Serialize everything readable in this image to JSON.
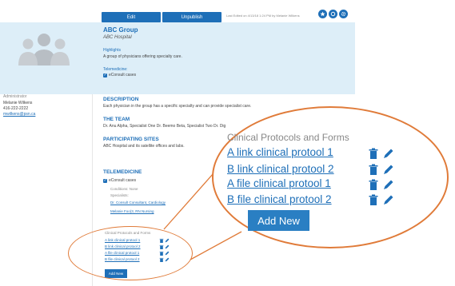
{
  "toolbar": {
    "edit_label": "Edit",
    "unpublish_label": "Unpublish",
    "last_edited": "Last Edited on 4/13/18 1:24 PM by Melanie Wilkens"
  },
  "header": {
    "title": "ABC Group",
    "subtitle": "ABC Hospital",
    "highlights_label": "Highlights",
    "highlights_text": "A group of physicians offering specialty care.",
    "telemedicine_label": "Telemedicine:",
    "telemedicine_item": "eConsult cases"
  },
  "sidebar": {
    "role": "Administrator",
    "name": "Melanie Wilkens",
    "phone": "416-222-2222",
    "email": "mwilkens@psn.ca"
  },
  "main": {
    "description_head": "DESCRIPTION",
    "description_text": "Each physician in the group has a specific specialty and can provide specialist care.",
    "team_head": "THE TEAM",
    "team_text": "Dr. Anu Alpha, Specialist One Dr. Beemo Beta, Specialist Two Dr. Dig",
    "sites_head": "PARTICIPATING SITES",
    "sites_text": "ABC Hospital and its satellite offices and labs.",
    "telemedicine_head": "TELEMEDICINE",
    "telemedicine_item": "eConsult cases",
    "conditions": "Conditions: None",
    "specialists_label": "Specialists:",
    "specialist_1": "Dr. Consult Consultant, Cardiology",
    "specialist_2": "Melanie Foo(3, RN Nursing"
  },
  "protocols_small": {
    "title": "Clinical Protocols and Forms",
    "links": [
      "A link clinical protool 1",
      "B link clinical protool 2",
      "A file clinical protool 1",
      "B file clinical protool 2"
    ],
    "add_label": "Add New"
  },
  "protocols_zoom": {
    "title": "Clinical Protocols and Forms",
    "links": [
      "A link clinical protool 1",
      "B link clinical protool 2",
      "A file clinical protool 1",
      "B file clinical protool 2"
    ],
    "add_label": "Add New"
  },
  "colors": {
    "accent": "#1e6fb8",
    "callout": "#e07b39",
    "header_band": "#ddeef8"
  }
}
